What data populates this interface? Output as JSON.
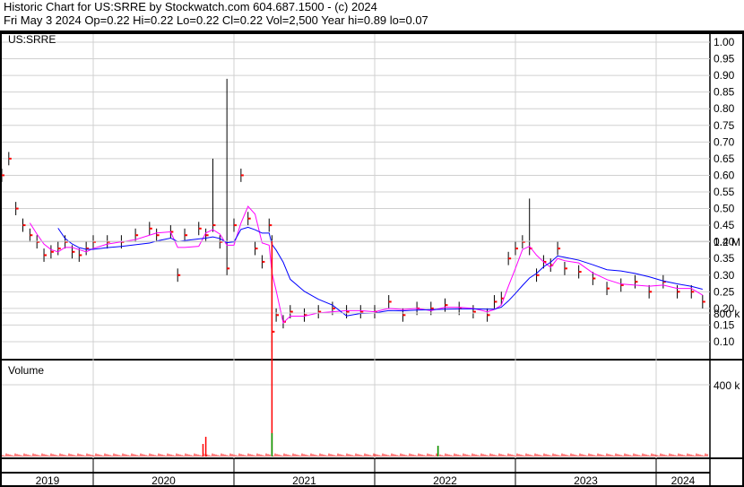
{
  "header": {
    "title": "Historic Chart for US:SRRE by Stockwatch.com 604.687.1500 - (c) 2024",
    "quote": "Fri May  3 2024   Op=0.22  Hi=0.22  Lo=0.22  Cl=0.22  Vol=2,500   Year hi=0.89  lo=0.07"
  },
  "chart_data": [
    {
      "type": "line",
      "title": "US:SRRE",
      "ylim": [
        0.05,
        1.02
      ],
      "yticks": [
        "1.00",
        "0.95",
        "0.90",
        "0.85",
        "0.80",
        "0.75",
        "0.70",
        "0.65",
        "0.60",
        "0.55",
        "0.50",
        "0.45",
        "0.40",
        "0.35",
        "0.30",
        "0.25",
        "0.20",
        "0.15",
        "0.10"
      ],
      "colors": {
        "price": "#000000",
        "close_tick": "#ff0000",
        "ma_short": "#ff00ff",
        "ma_long": "#0000ff"
      },
      "x": [
        2019.35,
        2019.4,
        2019.45,
        2019.5,
        2019.55,
        2019.6,
        2019.65,
        2019.7,
        2019.75,
        2019.8,
        2019.85,
        2019.9,
        2019.95,
        2020.0,
        2020.1,
        2020.2,
        2020.3,
        2020.4,
        2020.45,
        2020.55,
        2020.6,
        2020.65,
        2020.75,
        2020.8,
        2020.85,
        2020.9,
        2020.95,
        2021.0,
        2021.05,
        2021.1,
        2021.15,
        2021.2,
        2021.25,
        2021.27,
        2021.3,
        2021.35,
        2021.4,
        2021.5,
        2021.6,
        2021.7,
        2021.8,
        2021.9,
        2022.0,
        2022.1,
        2022.2,
        2022.3,
        2022.4,
        2022.5,
        2022.6,
        2022.7,
        2022.8,
        2022.85,
        2022.9,
        2022.95,
        2023.0,
        2023.05,
        2023.1,
        2023.15,
        2023.2,
        2023.25,
        2023.3,
        2023.35,
        2023.45,
        2023.55,
        2023.65,
        2023.75,
        2023.85,
        2023.95,
        2024.05,
        2024.15,
        2024.25,
        2024.33
      ],
      "close": [
        0.6,
        0.65,
        0.5,
        0.45,
        0.42,
        0.4,
        0.36,
        0.37,
        0.38,
        0.4,
        0.37,
        0.36,
        0.38,
        0.4,
        0.4,
        0.4,
        0.42,
        0.44,
        0.42,
        0.43,
        0.3,
        0.42,
        0.44,
        0.42,
        0.45,
        0.4,
        0.32,
        0.45,
        0.6,
        0.47,
        0.38,
        0.34,
        0.45,
        0.13,
        0.18,
        0.16,
        0.19,
        0.18,
        0.19,
        0.2,
        0.19,
        0.19,
        0.19,
        0.22,
        0.18,
        0.2,
        0.2,
        0.21,
        0.2,
        0.19,
        0.18,
        0.22,
        0.23,
        0.35,
        0.38,
        0.4,
        0.38,
        0.3,
        0.34,
        0.33,
        0.38,
        0.32,
        0.31,
        0.29,
        0.26,
        0.27,
        0.28,
        0.25,
        0.28,
        0.25,
        0.25,
        0.22
      ],
      "high": {
        "2020.95": 0.89,
        "2020.85": 0.65,
        "2021.27": 0.42,
        "2023.1": 0.53
      },
      "low": {
        "2021.27": 0.07
      }
    },
    {
      "type": "bar",
      "title": "Volume",
      "yticks": [
        "1.2 M",
        "800 k",
        "400 k"
      ],
      "ylim": [
        0,
        1400000
      ],
      "colors": {
        "down": "#ff0000",
        "up": "#00a000"
      },
      "spikes": [
        {
          "x": 2021.27,
          "value": 1200000,
          "up": 130000
        },
        {
          "x": 2020.8,
          "value": 110000,
          "up": 0
        },
        {
          "x": 2020.78,
          "value": 70000,
          "up": 0
        },
        {
          "x": 2022.45,
          "value": 60000,
          "up": 60000
        }
      ]
    },
    {
      "type": "axis",
      "xlabels": [
        "2019",
        "2020",
        "2021",
        "2022",
        "2023",
        "2024"
      ]
    }
  ]
}
